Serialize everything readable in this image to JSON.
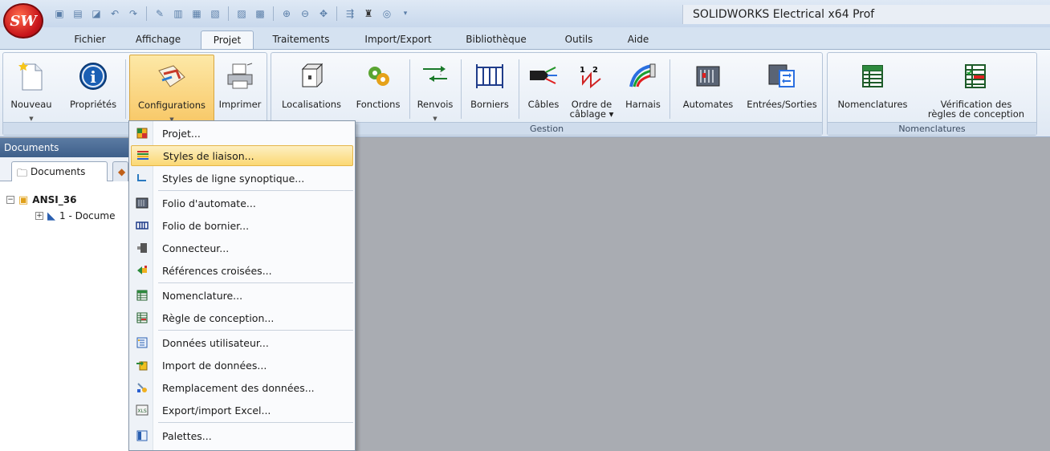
{
  "app": {
    "logo_text": "SW",
    "window_title": "SOLIDWORKS Electrical x64 Prof"
  },
  "qat_icons": [
    "project-icon",
    "save-icon",
    "print-preview-icon",
    "undo-icon",
    "redo-icon",
    "draw-icon",
    "copy-icon",
    "paste-icon",
    "paste-special-icon",
    "doc-icon",
    "doc2-icon",
    "zoom-icon",
    "zoom-out-icon",
    "pan-icon",
    "binoculars-icon",
    "find-icon",
    "snap-icon"
  ],
  "tabs": [
    "Fichier",
    "Affichage",
    "Projet",
    "Traitements",
    "Import/Export",
    "Bibliothèque",
    "Outils",
    "Aide"
  ],
  "active_tab": "Projet",
  "ribbon": {
    "group_projet": {
      "label": "P",
      "nouveau": "Nouveau",
      "proprietes": "Propriétés",
      "configurations": "Configurations",
      "imprimer": "Imprimer"
    },
    "group_gestion": {
      "label": "Gestion",
      "localisations": "Localisations",
      "fonctions": "Fonctions",
      "renvois": "Renvois",
      "borniers": "Borniers",
      "cables": "Câbles",
      "ordre_line1": "Ordre de",
      "ordre_line2": "câblage",
      "harnais": "Harnais",
      "automates": "Automates",
      "entrees_sorties": "Entrées/Sorties"
    },
    "group_nomenclatures": {
      "label": "Nomenclatures",
      "nomenclatures": "Nomenclatures",
      "verif_line1": "Vérification des",
      "verif_line2": "règles de conception"
    }
  },
  "documents_panel": {
    "header": "Documents",
    "tab_label": "Documents",
    "tree": {
      "root": "ANSI_36",
      "child": "1 - Docume"
    }
  },
  "menu": {
    "items": [
      "Projet...",
      "Styles de liaison...",
      "Styles de ligne synoptique...",
      "Folio d'automate...",
      "Folio de bornier...",
      "Connecteur...",
      "Références croisées...",
      "Nomenclature...",
      "Règle de conception...",
      "Données utilisateur...",
      "Import de données...",
      "Remplacement des données...",
      "Export/import Excel...",
      "Palettes..."
    ],
    "highlighted": "Styles de liaison..."
  },
  "colors": {
    "accent_highlight": "#fbd873",
    "panel_header": "#4a6b95",
    "logo_red": "#c8151b"
  }
}
